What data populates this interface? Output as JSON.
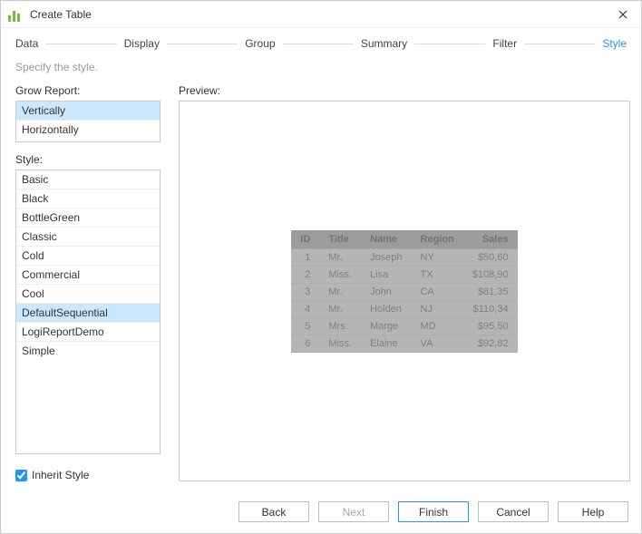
{
  "window": {
    "title": "Create Table"
  },
  "wizard": {
    "steps": [
      "Data",
      "Display",
      "Group",
      "Summary",
      "Filter",
      "Style"
    ],
    "active_index": 5,
    "subtitle": "Specify the style."
  },
  "grow": {
    "label": "Grow Report:",
    "options": [
      "Vertically",
      "Horizontally"
    ],
    "selected_index": 0
  },
  "style": {
    "label": "Style:",
    "options": [
      "Basic",
      "Black",
      "BottleGreen",
      "Classic",
      "Cold",
      "Commercial",
      "Cool",
      "DefaultSequential",
      "LogiReportDemo",
      "Simple"
    ],
    "selected_index": 7
  },
  "inherit": {
    "label": "Inherit Style",
    "checked": true
  },
  "preview": {
    "label": "Preview:",
    "columns": [
      "ID",
      "Title",
      "Name",
      "Region",
      "Sales"
    ],
    "rows": [
      {
        "id": "1",
        "title": "Mr.",
        "name": "Joseph",
        "region": "NY",
        "sales": "$50,60"
      },
      {
        "id": "2",
        "title": "Miss.",
        "name": "Lisa",
        "region": "TX",
        "sales": "$108,90"
      },
      {
        "id": "3",
        "title": "Mr.",
        "name": "John",
        "region": "CA",
        "sales": "$81,35"
      },
      {
        "id": "4",
        "title": "Mr.",
        "name": "Holden",
        "region": "NJ",
        "sales": "$110,34"
      },
      {
        "id": "5",
        "title": "Mrs.",
        "name": "Marge",
        "region": "MD",
        "sales": "$95,50"
      },
      {
        "id": "6",
        "title": "Miss.",
        "name": "Elaine",
        "region": "VA",
        "sales": "$92,82"
      }
    ]
  },
  "buttons": {
    "back": "Back",
    "next": "Next",
    "finish": "Finish",
    "cancel": "Cancel",
    "help": "Help"
  }
}
